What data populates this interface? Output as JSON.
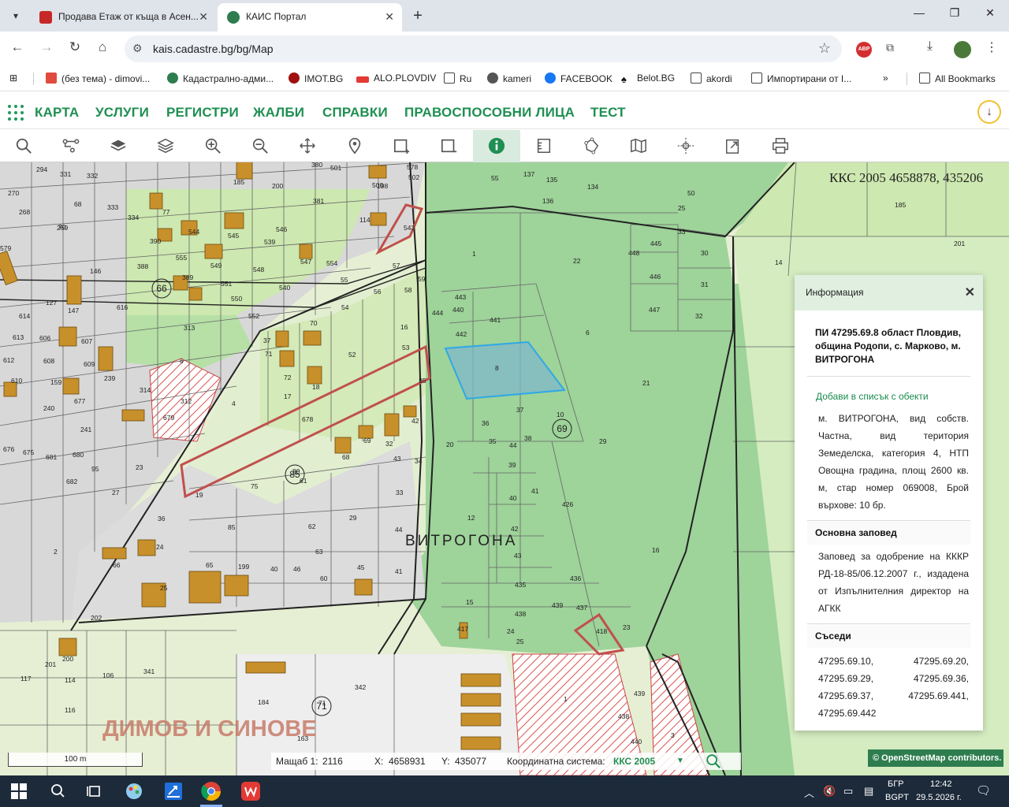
{
  "browser": {
    "tabs": [
      {
        "title": "Продава Етаж от къща в Асен...",
        "active": false
      },
      {
        "title": "КАИС Портал",
        "active": true
      }
    ],
    "url": "kais.cadastre.bg/bg/Map",
    "bookmarks": [
      "(без тема) - dimovi...",
      "Кадастрално-адми...",
      "IMOT.BG",
      "ALO.PLOVDIV",
      "Ru",
      "kameri",
      "FACEBOOK",
      "Belot.BG",
      "akordi",
      "Импортирани от I...",
      "All Bookmarks"
    ]
  },
  "site_nav": [
    "КАРТА",
    "УСЛУГИ",
    "РЕГИСТРИ",
    "ЖАЛБИ",
    "СПРАВКИ",
    "ПРАВОСПОСОБНИ ЛИЦА",
    "ТЕСТ"
  ],
  "map_tools": [
    "search",
    "layers-tree",
    "layers",
    "layers-stack",
    "zoom-in",
    "zoom-out",
    "pan",
    "location",
    "add-selection",
    "remove-selection",
    "info",
    "measure",
    "polygon",
    "map",
    "crosshair",
    "export",
    "print"
  ],
  "map": {
    "coord_readout": "ККС 2005 4658878, 435206",
    "locality_label": "ВИТРОГОНА",
    "company_label": "ДИМОВ И СИНОВЕ",
    "labels": [
      "294",
      "331",
      "332",
      "270",
      "68",
      "333",
      "268",
      "269",
      "334",
      "70",
      "146",
      "579",
      "127",
      "147",
      "616",
      "614",
      "613",
      "606",
      "607",
      "612",
      "608",
      "609",
      "610",
      "159",
      "677",
      "239",
      "240",
      "241",
      "676",
      "675",
      "681",
      "680",
      "682",
      "95",
      "27",
      "2",
      "36",
      "66",
      "24",
      "25",
      "65",
      "199",
      "202",
      "200",
      "201",
      "114",
      "116",
      "117",
      "106",
      "341",
      "342",
      "184",
      "163",
      "200",
      "185",
      "381",
      "380",
      "501",
      "500",
      "578",
      "502",
      "198",
      "114",
      "543",
      "544",
      "545",
      "539",
      "546",
      "547",
      "554",
      "555",
      "549",
      "548",
      "540",
      "551",
      "550",
      "552",
      "389",
      "390",
      "388",
      "77",
      "313",
      "314",
      "312",
      "6",
      "4",
      "678",
      "679",
      "23",
      "19",
      "75",
      "85",
      "80",
      "61",
      "62",
      "63",
      "60",
      "46",
      "40",
      "29",
      "68",
      "69",
      "32",
      "42",
      "43",
      "44",
      "41",
      "45",
      "33",
      "34",
      "35",
      "37",
      "70",
      "71",
      "72",
      "17",
      "18",
      "52",
      "53",
      "54",
      "55",
      "56",
      "57",
      "58",
      "59",
      "16",
      "1",
      "22",
      "443",
      "440",
      "442",
      "441",
      "444",
      "8",
      "6",
      "37",
      "36",
      "10",
      "35",
      "38",
      "44",
      "20",
      "21",
      "29",
      "39",
      "40",
      "41",
      "42",
      "43",
      "12",
      "15",
      "435",
      "438",
      "436",
      "437",
      "439",
      "417",
      "24",
      "25",
      "418",
      "23",
      "16",
      "426",
      "445",
      "446",
      "447",
      "448",
      "30",
      "31",
      "32",
      "33",
      "50",
      "25",
      "55",
      "137",
      "135",
      "134",
      "136",
      "185",
      "14",
      "201",
      "439",
      "438",
      "440",
      "1",
      "3",
      "71"
    ],
    "circled_labels": [
      "66",
      "85",
      "69",
      "71"
    ]
  },
  "info_panel": {
    "title": "Информация",
    "parcel_title": "ПИ 47295.69.8 област Пловдив, община Родопи, с. Марково, м. ВИТРОГОНА",
    "add_to_list": "Добави в списък с обекти",
    "description": "м. ВИТРОГОНА, вид собств. Частна, вид територия Земеделска, категория 4, НТП Овощна градина, площ 2600 кв. м, стар номер 069008, Брой върхове: 10 бр.",
    "order_heading": "Основна заповед",
    "order_text": "Заповед за одобрение на КККР РД-18-85/06.12.2007 г., издадена от Изпълнителния директор на АГКК",
    "neighbors_heading": "Съседи",
    "neighbors": [
      "47295.69.10,",
      "47295.69.20,",
      "47295.69.29,",
      "47295.69.36,",
      "47295.69.37,",
      "47295.69.441,",
      "47295.69.442"
    ]
  },
  "status": {
    "scale_bar_label": "100 m",
    "scale_label": "Мащаб 1:",
    "scale_value": "2116",
    "x_label": "X:",
    "x_value": "4658931",
    "y_label": "Y:",
    "y_value": "435077",
    "crs_label": "Координатна система:",
    "crs_value": "ККС 2005",
    "osm_credit": "© OpenStreetMap contributors."
  },
  "taskbar": {
    "lang_top": "БГР",
    "lang_bottom": "BGPT",
    "time": "12:42",
    "date": "29.5.2026 г."
  },
  "colors": {
    "brand_green": "#1f8f52",
    "parcel_highlight": "#2fa8e6",
    "forest": "#9ed39a",
    "agri": "#cde8b0",
    "urban": "#d8d8d8",
    "building": "#c8902a"
  }
}
